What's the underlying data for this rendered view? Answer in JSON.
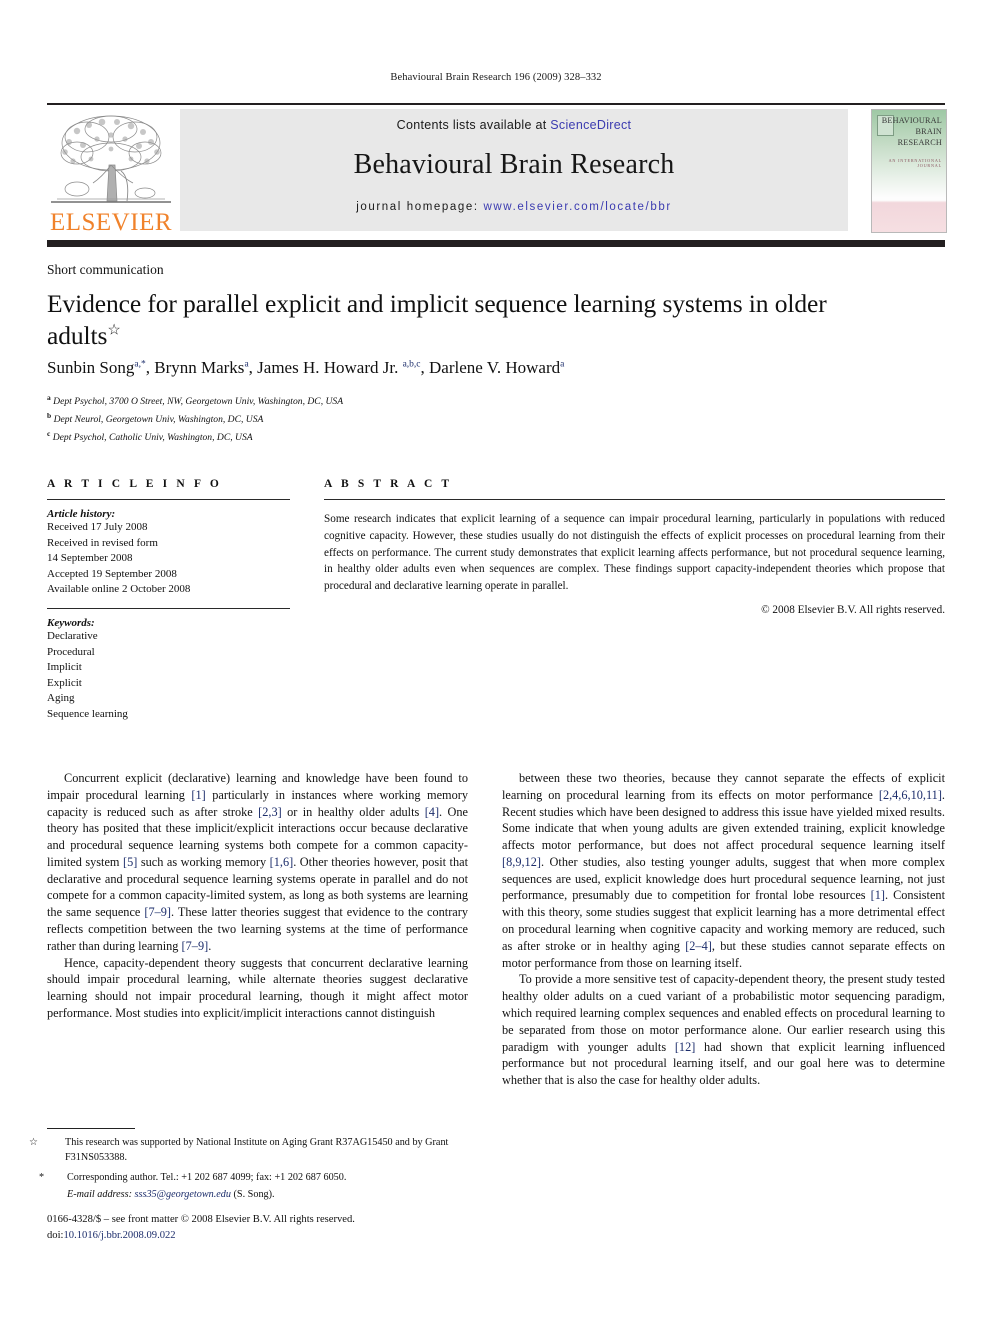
{
  "running_head": "Behavioural Brain Research 196 (2009) 328–332",
  "masthead": {
    "publisher_name": "ELSEVIER",
    "contents_prefix": "Contents lists available at ",
    "contents_link": "ScienceDirect",
    "journal_title": "Behavioural Brain Research",
    "homepage_prefix": "journal homepage: ",
    "homepage_url": "www.elsevier.com/locate/bbr",
    "cover": {
      "line1": "BEHAVIOURAL",
      "line2": "BRAIN",
      "line3": "RESEARCH",
      "subtitle": "AN INTERNATIONAL JOURNAL"
    }
  },
  "article": {
    "type": "Short communication",
    "title": "Evidence for parallel explicit and implicit sequence learning systems in older adults",
    "title_footnote_mark": "☆",
    "authors_html": "Sunbin Song, Brynn Marks, James H. Howard Jr., Darlene V. Howard",
    "author_list": [
      {
        "name": "Sunbin Song",
        "sup": "a,*"
      },
      {
        "name": "Brynn Marks",
        "sup": "a"
      },
      {
        "name": "James H. Howard Jr.",
        "sup": "a,b,c"
      },
      {
        "name": "Darlene V. Howard",
        "sup": "a"
      }
    ],
    "affiliations": [
      {
        "mark": "a",
        "text": "Dept Psychol, 3700 O Street, NW, Georgetown Univ, Washington, DC, USA"
      },
      {
        "mark": "b",
        "text": "Dept Neurol, Georgetown Univ, Washington, DC, USA"
      },
      {
        "mark": "c",
        "text": "Dept Psychol, Catholic Univ, Washington, DC, USA"
      }
    ]
  },
  "info": {
    "heading": "A R T I C L E    I N F O",
    "history_label": "Article history:",
    "history": [
      "Received 17 July 2008",
      "Received in revised form",
      "14 September 2008",
      "Accepted 19 September 2008",
      "Available online 2 October 2008"
    ],
    "keywords_label": "Keywords:",
    "keywords": [
      "Declarative",
      "Procedural",
      "Implicit",
      "Explicit",
      "Aging",
      "Sequence learning"
    ]
  },
  "abstract": {
    "heading": "A B S T R A C T",
    "text": "Some research indicates that explicit learning of a sequence can impair procedural learning, particularly in populations with reduced cognitive capacity. However, these studies usually do not distinguish the effects of explicit processes on procedural learning from their effects on performance. The current study demonstrates that explicit learning affects performance, but not procedural sequence learning, in healthy older adults even when sequences are complex. These findings support capacity-independent theories which propose that procedural and declarative learning operate in parallel.",
    "copyright": "© 2008 Elsevier B.V. All rights reserved."
  },
  "body": {
    "left_paragraphs": [
      "Concurrent explicit (declarative) learning and knowledge have been found to impair procedural learning [1] particularly in instances where working memory capacity is reduced such as after stroke [2,3] or in healthy older adults [4]. One theory has posited that these implicit/explicit interactions occur because declarative and procedural sequence learning systems both compete for a common capacity-limited system [5] such as working memory [1,6]. Other theories however, posit that declarative and procedural sequence learning systems operate in parallel and do not compete for a common capacity-limited system, as long as both systems are learning the same sequence [7–9]. These latter theories suggest that evidence to the contrary reflects competition between the two learning systems at the time of performance rather than during learning [7–9].",
      "Hence, capacity-dependent theory suggests that concurrent declarative learning should impair procedural learning, while alternate theories suggest declarative learning should not impair procedural learning, though it might affect motor performance. Most studies into explicit/implicit interactions cannot distinguish"
    ],
    "right_paragraphs": [
      "between these two theories, because they cannot separate the effects of explicit learning on procedural learning from its effects on motor performance [2,4,6,10,11]. Recent studies which have been designed to address this issue have yielded mixed results. Some indicate that when young adults are given extended training, explicit knowledge affects motor performance, but does not affect procedural sequence learning itself [8,9,12]. Other studies, also testing younger adults, suggest that when more complex sequences are used, explicit knowledge does hurt procedural sequence learning, not just performance, presumably due to competition for frontal lobe resources [1]. Consistent with this theory, some studies suggest that explicit learning has a more detrimental effect on procedural learning when cognitive capacity and working memory are reduced, such as after stroke or in healthy aging [2–4], but these studies cannot separate effects on motor performance from those on learning itself.",
      "To provide a more sensitive test of capacity-dependent theory, the present study tested healthy older adults on a cued variant of a probabilistic motor sequencing paradigm, which required learning complex sequences and enabled effects on procedural learning to be separated from those on motor performance alone. Our earlier research using this paradigm with younger adults [12] had shown that explicit learning influenced performance but not procedural learning itself, and our goal here was to determine whether that is also the case for healthy older adults."
    ]
  },
  "footnotes": {
    "grant_mark": "☆",
    "grant_text": "This research was supported by National Institute on Aging Grant R37AG15450 and by Grant F31NS053388.",
    "corr_mark": "*",
    "corr_text": "Corresponding author. Tel.: +1 202 687 4099; fax: +1 202 687 6050.",
    "email_label": "E-mail address:",
    "email": "sss35@georgetown.edu",
    "email_who": "(S. Song)."
  },
  "footer": {
    "issn_line": "0166-4328/$ – see front matter © 2008 Elsevier B.V. All rights reserved.",
    "doi_label": "doi:",
    "doi_value": "10.1016/j.bbr.2008.09.022"
  },
  "colors": {
    "link_blue": "#3b3bb0",
    "ref_blue": "#1c2d6b",
    "elsevier_orange": "#f0822b",
    "band_grey": "#e8e8e8",
    "rule_dark": "#231f20"
  }
}
